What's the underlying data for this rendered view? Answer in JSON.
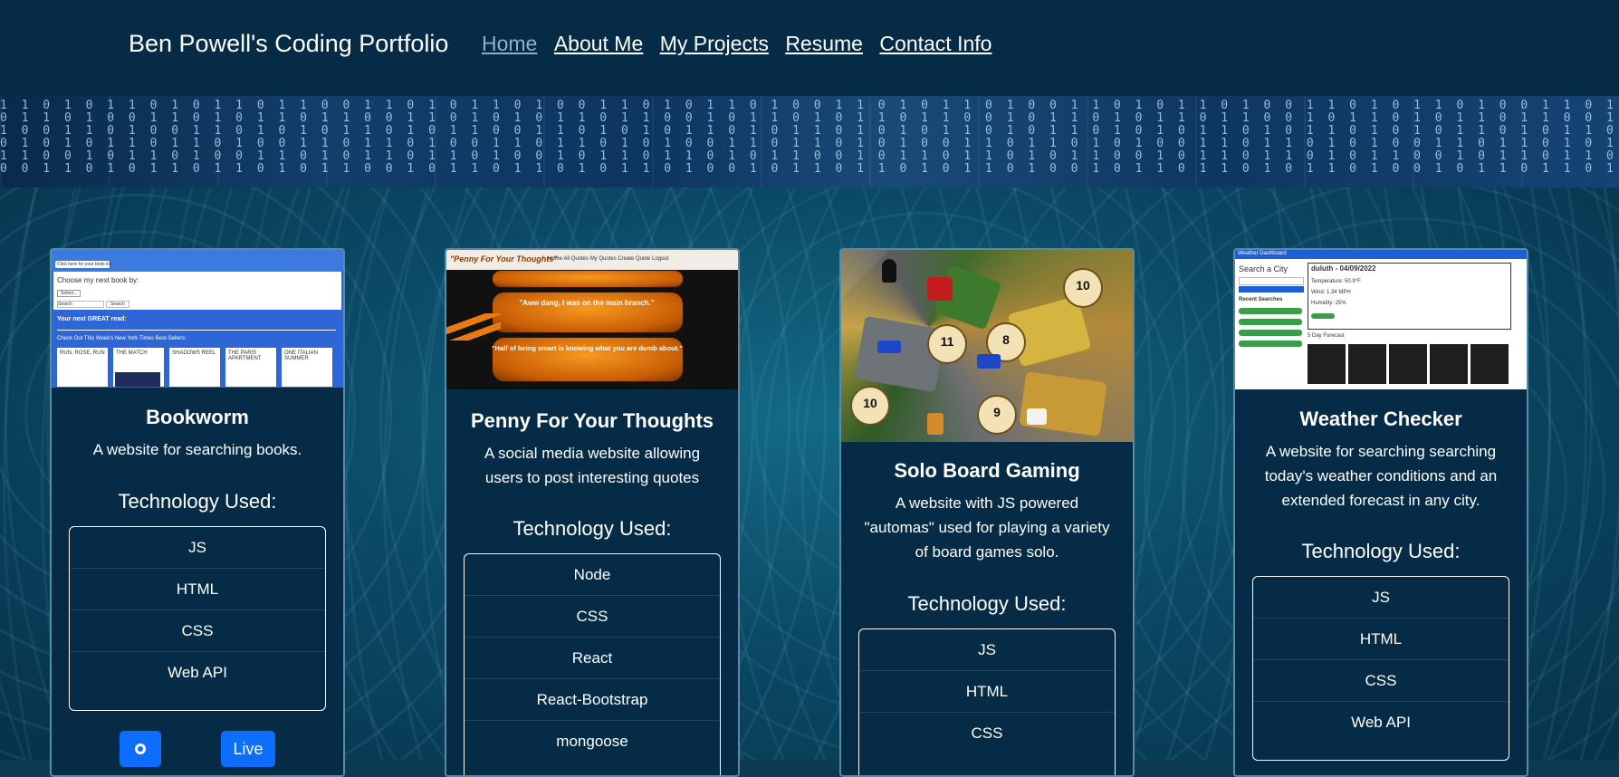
{
  "navbar": {
    "brand": "Ben Powell's Coding Portfolio",
    "links": [
      {
        "label": "Home",
        "active": true
      },
      {
        "label": "About Me"
      },
      {
        "label": "My Projects"
      },
      {
        "label": "Resume"
      },
      {
        "label": "Contact Info"
      }
    ]
  },
  "banner": {
    "code": "1 1 0 1 0 1 1 0 1 0 1 1 0 1 1 0 0 1 1 0 1 0 1 1 0 1 0 0 1 1 0 1 0 1 1 0 1 0 0 1 1 0 1 0 1 1 0 1 0 0 1 1 0 1 0 1 1 0 1 0 0 1 1 0 1 0 1 1 0 1 0 0 1 1 0 1 0 1 1 0 1 0 0 1 1 0 1\n0 1 1 0 1 0 0 1 1 0 1 0 1 1 0 1 1 0 0 1 1 0 1 0 1 0 1 1 0 1 1 0 0 1 0 1 1 0 1 0 1 1 0 1 1 0 0 1 0 1 1 0 1 0 1 1 0 1 1 0 0 1 0 1 1 0 1 0 1 1 0 1 1 0 0 1 0 1 1 0 1 0 1 1 0 1 1\n1 0 0 1 1 0 1 0 0 1 1 0 1 0 1 0 1 1 0 1 0 1 1 0 0 1 1 0 1 0 1 0 1 1 0 1 0 1 1 0 1 0 1 0 1 1 0 1 0 1 1 0 1 0 1 0 1 1 0 1 0 1 1 0 1 0 1 0 1 1 0 1 0 1 1 0 1 0 1 0 1 1 0 1 0 1 1\n0 1 0 1 0 1 1 0 1 1 0 1 0 0 1 1 0 1 1 0 1 0 0 1 1 0 1 1 0 1 0 1 0 0 1 1 0 1 1 0 1 0 1 0 0 1 1 0 1 1 0 1 0 1 0 0 1 1 0 1 1 0 1 0 1 0 0 1 1 0 1 1 0 1 0 1 0 0 1 1 0 1 1 0 1 0 1\n1 1 0 0 1 0 1 1 0 1 0 0 1 1 0 1 0 1 1 0 1 1 0 1 0 0 1 0 1 1 0 1 1 0 1 0 1 1 0 0 1 0 1 1 0 1 1 0 1 0 1 1 0 0 1 0 1 1 0 1 1 0 1 0 1 1 0 0 1 0 1 1 0 1 1 0 1 0 1 1 0 0 1 0 1 1 0\n0 0 1 1 0 1 0 1 1 0 1 1 0 1 0 1 1 0 0 1 0 1 1 0 1 1 0 1 0 1 1 0 1 0 0 1 0 1 1 0 1 1 0 1 0 1 1 0 1 0 0 1 0 1 1 0 1 1 0 1 0 1 1 0 1 0 0 1 0 1 1 0 1 1 0 1 0 1 1 0 1 0 0 1 0 1 1"
  },
  "cards": [
    {
      "title": "Bookworm",
      "description": "A website for searching books.",
      "tech_heading": "Technology Used:",
      "tech": [
        "JS",
        "HTML",
        "CSS",
        "Web API"
      ],
      "buttons": {
        "github_icon": "github-icon",
        "live": "Live"
      },
      "preview": {
        "click_here": "Click here for your book list",
        "choose": "Choose my next book by:",
        "select": "Select...",
        "search": "Search",
        "search_btn": "Search",
        "next_read": "Your next GREAT read:",
        "bestsellers": "Check Out This Week's New York Times Best-Sellers:",
        "books": [
          "RUN, ROSE, RUN",
          "THE MATCH",
          "SHADOWS REEL",
          "THE PARIS APARTMENT",
          "ONE ITALIAN SUMMER"
        ]
      }
    },
    {
      "title": "Penny For Your Thoughts",
      "description": "A social media website allowing users to post interesting quotes",
      "tech_heading": "Technology Used:",
      "tech": [
        "Node",
        "CSS",
        "React",
        "React-Bootstrap",
        "mongoose"
      ],
      "preview": {
        "logo": "\"Penny For Your Thoughts\"",
        "menu": "Home  All Quotes  My Quotes  Create Quote  Logout",
        "quote1": "\"Aww dang, I was on the main branch.\"",
        "quote2": "\"Half of being smart is knowing what you are dumb about.\""
      }
    },
    {
      "title": "Solo Board Gaming",
      "description": "A website with JS powered \"automas\" used for playing a variety of board games solo.",
      "tech_heading": "Technology Used:",
      "tech": [
        "JS",
        "HTML",
        "CSS"
      ],
      "preview": {
        "numbers": [
          "10",
          "11",
          "9",
          "10",
          "8"
        ]
      }
    },
    {
      "title": "Weather Checker",
      "description": "A website for searching searching today's weather conditions and an extended forecast in any city.",
      "tech_heading": "Technology Used:",
      "tech": [
        "JS",
        "HTML",
        "CSS",
        "Web API"
      ],
      "preview": {
        "header": "Weather Dashboard",
        "search_city": "Search a City",
        "recent": "Recent Searches",
        "city_date": "duluth - 04/09/2022",
        "temp": "Temperature: 50.9°F",
        "wind": "Wind: 1.34 MPH",
        "humidity": "Humidity: 25%",
        "forecast": "5 Day Forecast"
      }
    }
  ],
  "colors": {
    "navbar": "#062b46",
    "card_bg": "#062b46",
    "button": "#0d6efd",
    "active_link": "#8fb0c6"
  }
}
